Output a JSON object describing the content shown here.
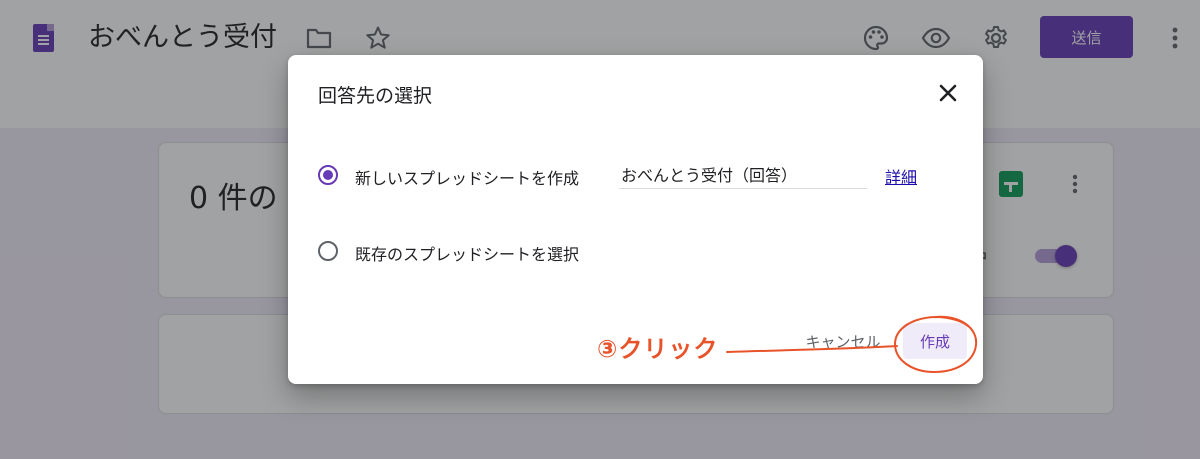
{
  "app": {
    "title": "おべんとう受付",
    "send_label": "送信",
    "icons": [
      "forms-logo-icon",
      "folder-icon",
      "star-icon",
      "palette-icon",
      "preview-eye-icon",
      "settings-gear-icon",
      "more-vert-icon"
    ]
  },
  "responses_card": {
    "count_label": "0 件の",
    "accepting_label": "付中",
    "accepting_on": true,
    "icons": [
      "sheets-icon",
      "more-vert-icon"
    ]
  },
  "dialog": {
    "title": "回答先の選択",
    "option_new_label": "新しいスプレッドシートを作成",
    "option_new_selected": true,
    "sheet_name_value": "おべんとう受付（回答）",
    "details_link": "詳細",
    "option_existing_label": "既存のスプレッドシートを選択",
    "option_existing_selected": false,
    "cancel_label": "キャンセル",
    "create_label": "作成"
  },
  "annotation": {
    "text": "③クリック",
    "color": "#e8532a"
  },
  "colors": {
    "accent": "#673ab7",
    "background": "#f0ebf8",
    "link": "#1a0dab"
  }
}
